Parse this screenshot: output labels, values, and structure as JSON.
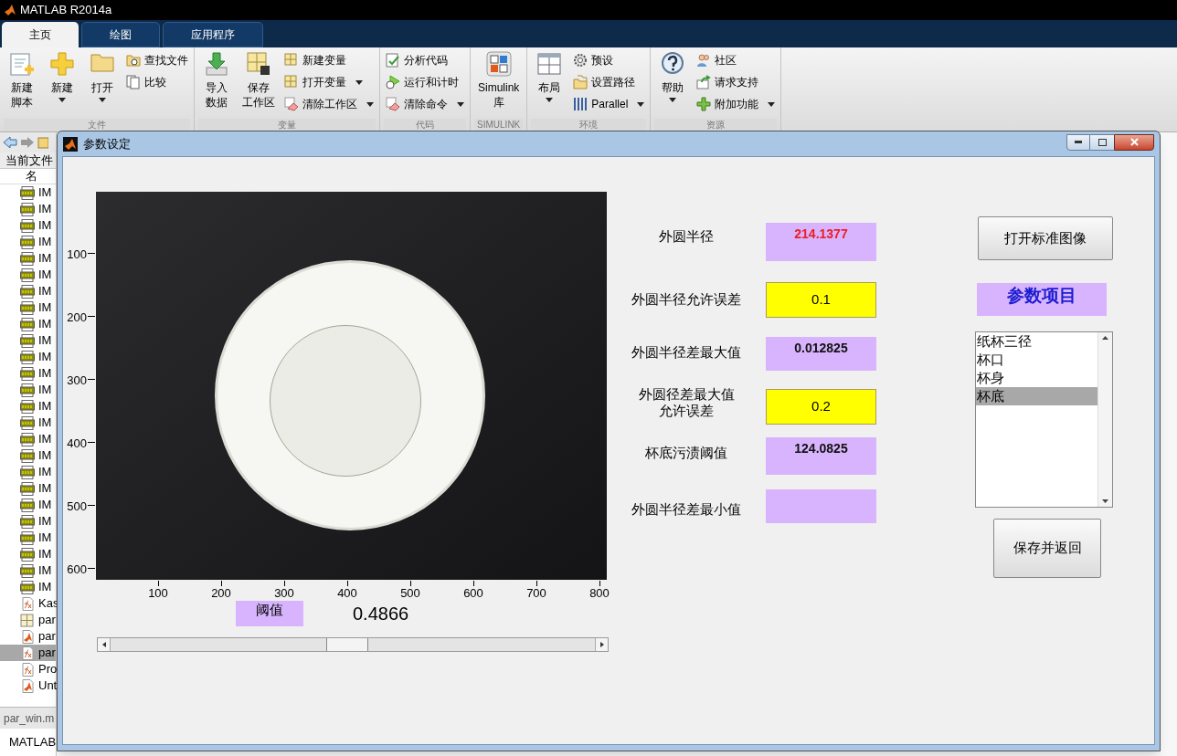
{
  "app": {
    "title": "MATLAB R2014a"
  },
  "tabs": [
    {
      "label": "主页",
      "selected": true
    },
    {
      "label": "绘图",
      "selected": false
    },
    {
      "label": "应用程序",
      "selected": false
    }
  ],
  "ribbon": {
    "groups": [
      {
        "label": "文件",
        "items": [
          {
            "lines": [
              "新建",
              "脚本"
            ],
            "kind": "large",
            "dropdown": false
          },
          {
            "lines": [
              "新建"
            ],
            "kind": "large",
            "dropdown": true
          },
          {
            "lines": [
              "打开"
            ],
            "kind": "large",
            "dropdown": true
          },
          {
            "label": "查找文件",
            "kind": "small",
            "dropdown": false
          },
          {
            "label": "比较",
            "kind": "small",
            "dropdown": false
          }
        ]
      },
      {
        "label": "变量",
        "items": [
          {
            "lines": [
              "导入",
              "数据"
            ],
            "kind": "large",
            "dropdown": false
          },
          {
            "lines": [
              "保存",
              "工作区"
            ],
            "kind": "large",
            "dropdown": false
          },
          {
            "label": "新建变量",
            "kind": "small",
            "dropdown": false
          },
          {
            "label": "打开变量",
            "kind": "small",
            "dropdown": true
          },
          {
            "label": "清除工作区",
            "kind": "small",
            "dropdown": true
          }
        ]
      },
      {
        "label": "代码",
        "items": [
          {
            "label": "分析代码",
            "kind": "small",
            "dropdown": false
          },
          {
            "label": "运行和计时",
            "kind": "small",
            "dropdown": false
          },
          {
            "label": "清除命令",
            "kind": "small",
            "dropdown": true
          }
        ]
      },
      {
        "label": "SIMULINK",
        "items": [
          {
            "lines": [
              "Simulink",
              "库"
            ],
            "kind": "large",
            "dropdown": false
          }
        ]
      },
      {
        "label": "环境",
        "items": [
          {
            "lines": [
              "布局"
            ],
            "kind": "large",
            "dropdown": true
          },
          {
            "label": "预设",
            "kind": "small",
            "dropdown": false
          },
          {
            "label": "设置路径",
            "kind": "small",
            "dropdown": false
          },
          {
            "label": "Parallel",
            "kind": "small",
            "dropdown": true
          }
        ]
      },
      {
        "label": "资源",
        "items": [
          {
            "lines": [
              "帮助"
            ],
            "kind": "large",
            "dropdown": true
          },
          {
            "label": "社区",
            "kind": "small",
            "dropdown": false
          },
          {
            "label": "请求支持",
            "kind": "small",
            "dropdown": false
          },
          {
            "label": "附加功能",
            "kind": "small",
            "dropdown": true
          }
        ]
      }
    ]
  },
  "file_browser": {
    "header": "当前文件",
    "column": "名",
    "files": [
      {
        "name": "IM",
        "kind": "jpg",
        "selected": false
      },
      {
        "name": "IM",
        "kind": "jpg",
        "selected": false
      },
      {
        "name": "IM",
        "kind": "jpg",
        "selected": false
      },
      {
        "name": "IM",
        "kind": "jpg",
        "selected": false
      },
      {
        "name": "IM",
        "kind": "jpg",
        "selected": false
      },
      {
        "name": "IM",
        "kind": "jpg",
        "selected": false
      },
      {
        "name": "IM",
        "kind": "jpg",
        "selected": false
      },
      {
        "name": "IM",
        "kind": "jpg",
        "selected": false
      },
      {
        "name": "IM",
        "kind": "jpg",
        "selected": false
      },
      {
        "name": "IM",
        "kind": "jpg",
        "selected": false
      },
      {
        "name": "IM",
        "kind": "jpg",
        "selected": false
      },
      {
        "name": "IM",
        "kind": "jpg",
        "selected": false
      },
      {
        "name": "IM",
        "kind": "jpg",
        "selected": false
      },
      {
        "name": "IM",
        "kind": "jpg",
        "selected": false
      },
      {
        "name": "IM",
        "kind": "jpg",
        "selected": false
      },
      {
        "name": "IM",
        "kind": "jpg",
        "selected": false
      },
      {
        "name": "IM",
        "kind": "jpg",
        "selected": false
      },
      {
        "name": "IM",
        "kind": "jpg",
        "selected": false
      },
      {
        "name": "IM",
        "kind": "jpg",
        "selected": false
      },
      {
        "name": "IM",
        "kind": "jpg",
        "selected": false
      },
      {
        "name": "IM",
        "kind": "jpg",
        "selected": false
      },
      {
        "name": "IM",
        "kind": "jpg",
        "selected": false
      },
      {
        "name": "IM",
        "kind": "jpg",
        "selected": false
      },
      {
        "name": "IM",
        "kind": "jpg",
        "selected": false
      },
      {
        "name": "IM",
        "kind": "jpg",
        "selected": false
      },
      {
        "name": "Kas",
        "kind": "function",
        "selected": false
      },
      {
        "name": "par",
        "kind": "figure",
        "selected": false
      },
      {
        "name": "par",
        "kind": "app",
        "selected": false
      },
      {
        "name": "par",
        "kind": "function",
        "selected": true
      },
      {
        "name": "Pro",
        "kind": "function",
        "selected": false
      },
      {
        "name": "Unt",
        "kind": "app",
        "selected": false
      }
    ],
    "details": "par_win.m",
    "command_window": "MATLAB"
  },
  "dialog": {
    "title": "参数设定",
    "axes": {
      "xticks": [
        "100",
        "200",
        "300",
        "400",
        "500",
        "600",
        "700",
        "800"
      ],
      "yticks": [
        "100",
        "200",
        "300",
        "400",
        "500",
        "600"
      ]
    },
    "threshold": {
      "label": "阈值",
      "value": "0.4866",
      "level": 0.4866
    },
    "fields": [
      {
        "label": "外圆半径",
        "kind": "output",
        "value": "214.1377",
        "highlighted": true
      },
      {
        "label": "外圆半径允许误差",
        "kind": "input",
        "value": "0.1"
      },
      {
        "label": "外圆半径差最大值",
        "kind": "output",
        "value": "0.012825",
        "highlighted": false
      },
      {
        "lines": [
          "外圆径差最大值",
          "允许误差"
        ],
        "kind": "input",
        "value": "0.2"
      },
      {
        "label": "杯底污渍阈值",
        "kind": "output",
        "value": "124.0825",
        "highlighted": false
      },
      {
        "label": "外圆半径差最小值",
        "kind": "output"
      }
    ],
    "open_button": "打开标准图像",
    "list_title": "参数项目",
    "list_items": [
      {
        "label": "纸杯三径",
        "selected": false
      },
      {
        "label": "杯口",
        "selected": false
      },
      {
        "label": "杯身",
        "selected": false
      },
      {
        "label": "杯底",
        "selected": true
      }
    ],
    "save_button": "保存并返回"
  }
}
